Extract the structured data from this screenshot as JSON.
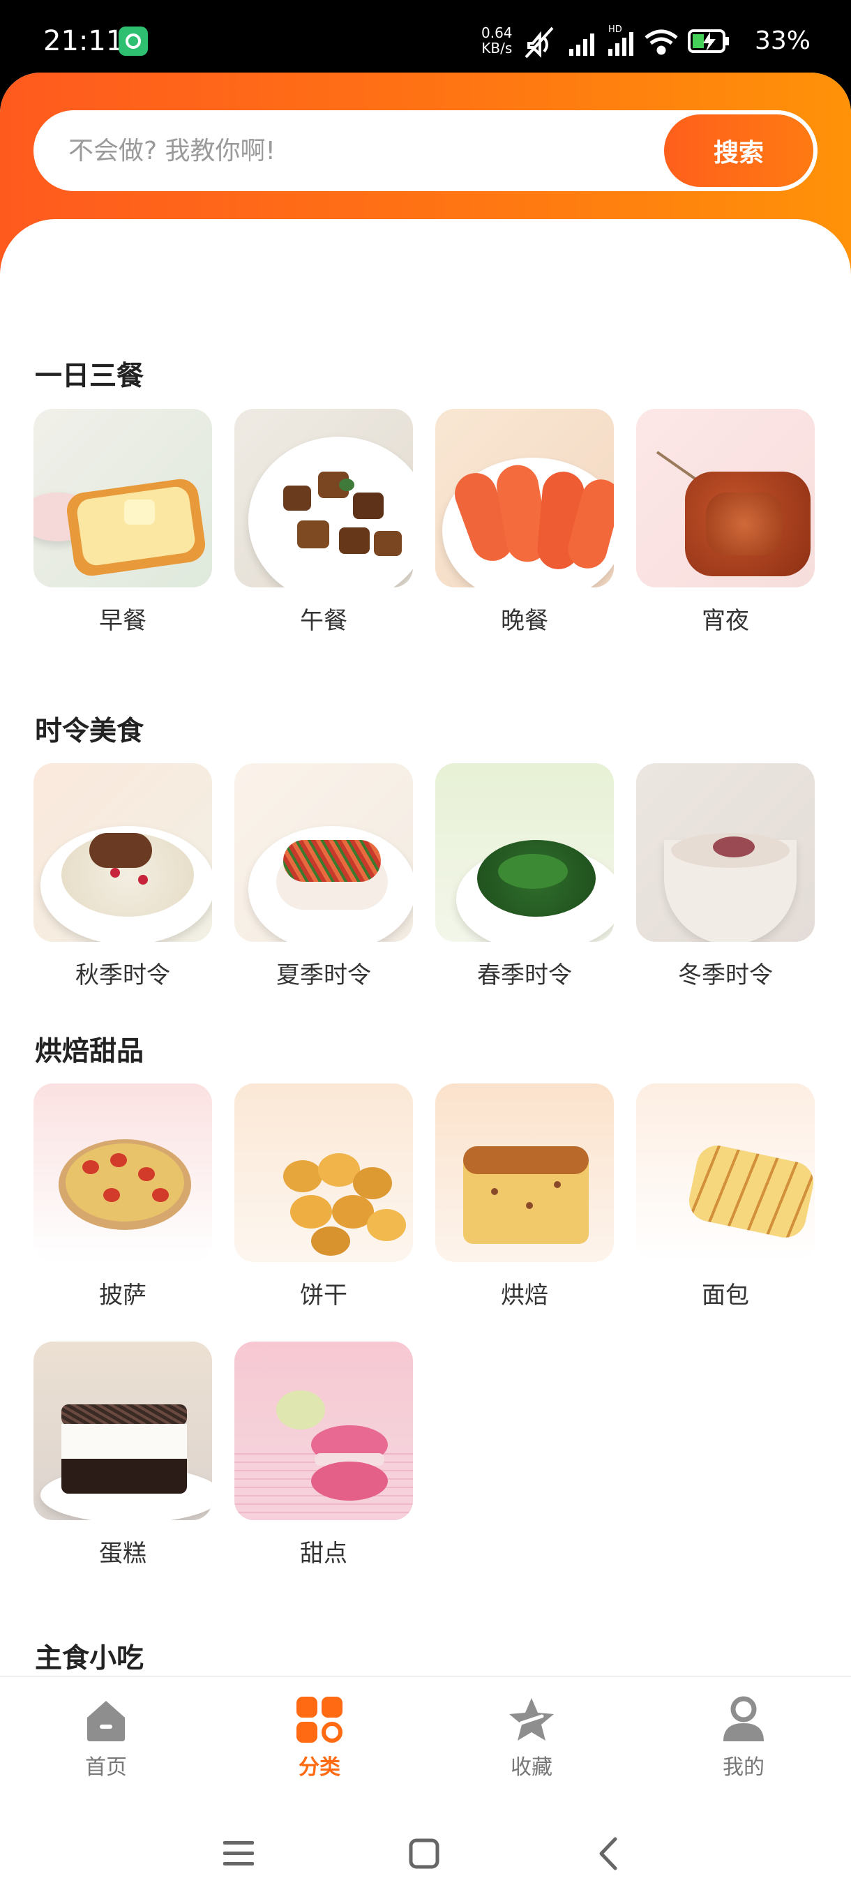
{
  "status_bar": {
    "time": "21:11",
    "net_speed_value": "0.64",
    "net_speed_unit": "KB/s",
    "battery": "33%"
  },
  "search": {
    "placeholder": "不会做? 我教你啊!",
    "button_label": "搜索"
  },
  "sections": [
    {
      "title": "一日三餐",
      "items": [
        "早餐",
        "午餐",
        "晚餐",
        "宵夜"
      ]
    },
    {
      "title": "时令美食",
      "items": [
        "秋季时令",
        "夏季时令",
        "春季时令",
        "冬季时令"
      ]
    },
    {
      "title": "烘焙甜品",
      "items": [
        "披萨",
        "饼干",
        "烘焙",
        "面包",
        "蛋糕",
        "甜点"
      ]
    },
    {
      "title": "主食小吃",
      "items": [
        "",
        "",
        "",
        ""
      ]
    }
  ],
  "bottom_nav": [
    {
      "label": "首页",
      "icon": "home-icon",
      "active": false
    },
    {
      "label": "分类",
      "icon": "category-icon",
      "active": true
    },
    {
      "label": "收藏",
      "icon": "star-icon",
      "active": false
    },
    {
      "label": "我的",
      "icon": "user-icon",
      "active": false
    }
  ],
  "colors": {
    "accent": "#ff6a13",
    "gradient_start": "#ff5a1e",
    "gradient_end": "#ff9208"
  }
}
